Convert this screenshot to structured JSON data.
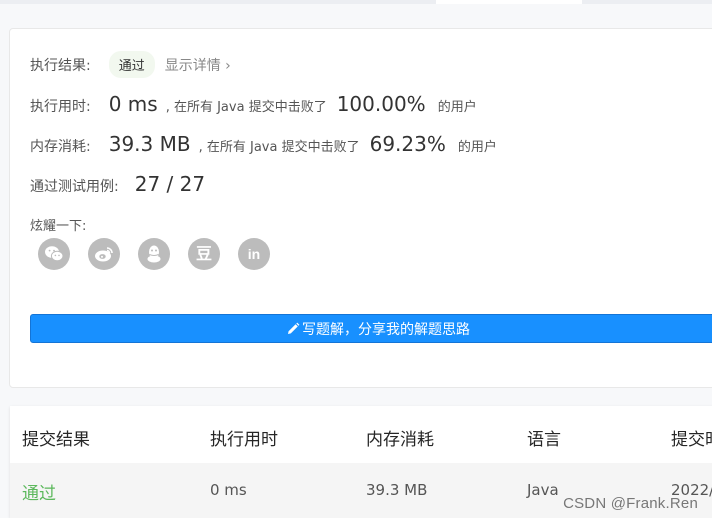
{
  "result": {
    "label": "执行结果:",
    "status": "通过",
    "details_link": "显示详情 ›"
  },
  "runtime": {
    "label": "执行用时:",
    "value": "0 ms",
    "beat_text": ", 在所有 Java 提交中击败了",
    "percent": "100.00%",
    "suffix": "的用户"
  },
  "memory": {
    "label": "内存消耗:",
    "value": "39.3 MB",
    "beat_text": ", 在所有 Java 提交中击败了",
    "percent": "69.23%",
    "suffix": "的用户"
  },
  "tests": {
    "label": "通过测试用例:",
    "value": "27 / 27"
  },
  "share": {
    "label": "炫耀一下:",
    "icons": [
      "wechat-icon",
      "weibo-icon",
      "qq-icon",
      "douban-icon",
      "linkedin-icon"
    ],
    "douban_glyph": "豆",
    "linkedin_glyph": "in"
  },
  "write_button": {
    "label": "写题解，分享我的解题思路",
    "color": "#1890ff"
  },
  "submissions": {
    "headers": [
      "提交结果",
      "执行用时",
      "内存消耗",
      "语言",
      "提交时"
    ],
    "rows": [
      {
        "status": "通过",
        "runtime": "0 ms",
        "memory": "39.3 MB",
        "language": "Java",
        "time": "2022/"
      }
    ],
    "pass_color": "#5cb85c"
  },
  "watermark": "CSDN @Frank.Ren"
}
